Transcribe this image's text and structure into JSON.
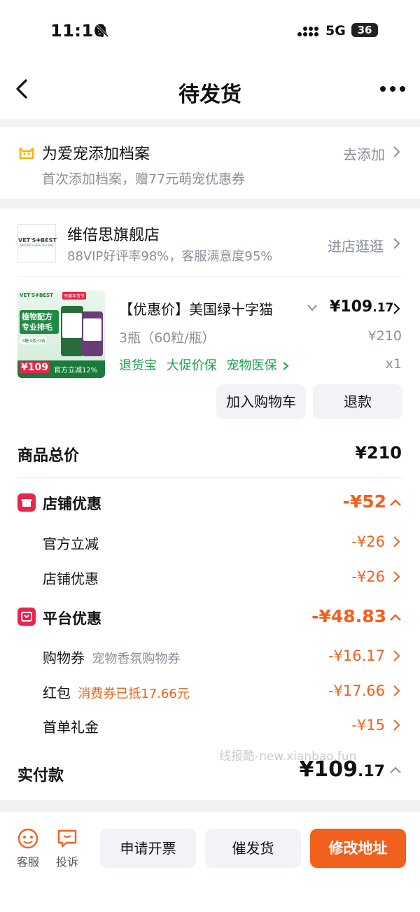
{
  "status_bar": {
    "time": "11:16",
    "network": "5G",
    "battery": "36"
  },
  "nav": {
    "title": "待发货"
  },
  "pet_profile": {
    "title": "为爱宠添加档案",
    "subtitle": "首次添加档案，赠77元萌宠优惠券",
    "action": "去添加"
  },
  "store": {
    "logo_text": "VET'S✚BEST",
    "logo_sub": "NATURE'S HEALTH CARE",
    "name": "维倍思旗舰店",
    "stats": "88VIP好评率98%，客服满意度95%",
    "action": "进店逛逛"
  },
  "product": {
    "image_text": {
      "brand": "VET'S✚BEST",
      "badge": "天猫年货节",
      "headline1": "植物配方",
      "headline2": "专业排毛",
      "chips": "0糖·0胶·0油",
      "price": "¥109",
      "promo": "官方立减12%"
    },
    "title": "【优惠价】美国绿十字猫",
    "price_main": "¥109",
    "price_decimal": ".17",
    "spec": "3瓶（60粒/瓶）",
    "original_price": "¥210",
    "tags": [
      "退货宝",
      "大促价保",
      "宠物医保"
    ],
    "quantity": "x1",
    "btn_cart": "加入购物车",
    "btn_refund": "退款"
  },
  "summary": {
    "total_label": "商品总价",
    "total_value": "¥210",
    "store_discount": {
      "label": "店铺优惠",
      "value": "-¥52",
      "items": [
        {
          "label": "官方立减",
          "value": "-¥26"
        },
        {
          "label": "店铺优惠",
          "value": "-¥26"
        }
      ]
    },
    "platform_discount": {
      "label": "平台优惠",
      "value": "-¥48.83",
      "coupon_label": "购物券",
      "coupon_note": "宠物香氛购物券",
      "coupon_value": "-¥16.17",
      "redpacket_label": "红包",
      "redpacket_note": "消费券已抵17.66元",
      "redpacket_value": "-¥17.66",
      "firstorder_label": "首单礼金",
      "firstorder_value": "-¥15"
    },
    "paid_label": "实付款",
    "paid_main": "¥109",
    "paid_decimal": ".17",
    "watermark": "线报酷-new.xianbao.fun"
  },
  "bottom": {
    "service_label": "客服",
    "complain_label": "投诉",
    "invoice_label": "申请开票",
    "urge_label": "催发货",
    "modify_label": "修改地址"
  },
  "colors": {
    "accent": "#f2601d",
    "discount_red": "#e8254a",
    "green": "#18a34a"
  }
}
